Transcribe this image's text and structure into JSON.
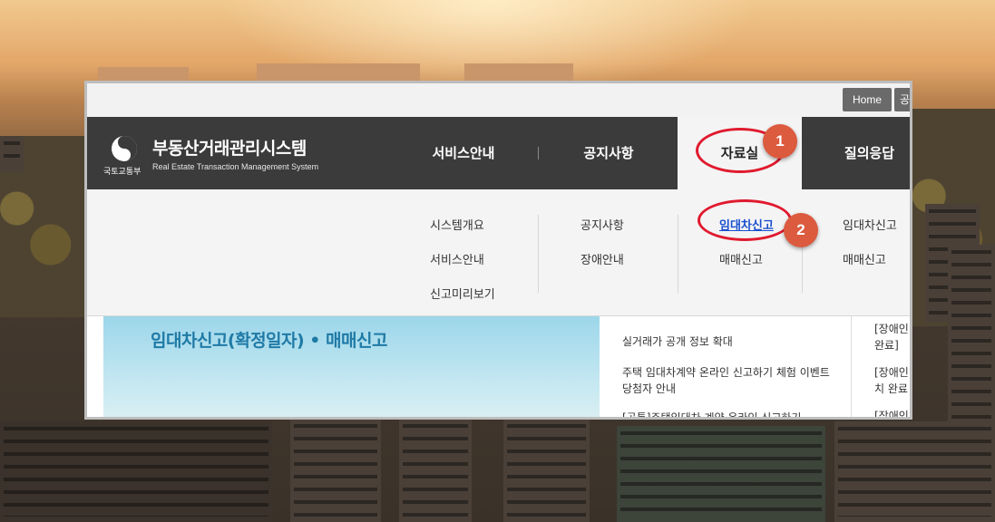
{
  "topbar": {
    "home_label": "Home",
    "second_label_partial": "공"
  },
  "logo": {
    "org": "국토교통부",
    "emblem": "taegeuk-emblem-icon"
  },
  "site": {
    "title": "부동산거래관리시스템",
    "subtitle": "Real Estate Transaction Management System"
  },
  "nav": {
    "items": [
      {
        "label": "서비스안내"
      },
      {
        "label": "공지사항"
      },
      {
        "label": "자료실",
        "active": true
      },
      {
        "label": "질의응답"
      }
    ]
  },
  "dropdown": {
    "col1": [
      "시스템개요",
      "서비스안내",
      "신고미리보기"
    ],
    "col2": [
      "공지사항",
      "장애안내"
    ],
    "col3": [
      "임대차신고",
      "매매신고"
    ],
    "col4": [
      "임대차신고",
      "매매신고"
    ]
  },
  "banner": {
    "title": "임대차신고(확정일자) • 매매신고"
  },
  "news": {
    "items": [
      "실거래가 공개 정보 확대",
      "주택 임대차계약 온라인 신고하기 체험 이벤트 당첨자 안내",
      "[공통]주택임대차 계약 온라인 신고하기"
    ]
  },
  "side": {
    "items": [
      "[장애인",
      "완료]",
      "[장애인",
      "치 완료",
      "[장애인"
    ]
  },
  "annotations": {
    "badge1": "1",
    "badge2": "2",
    "ring_color": "#e01a2e",
    "badge_color": "#dc5a3e"
  }
}
